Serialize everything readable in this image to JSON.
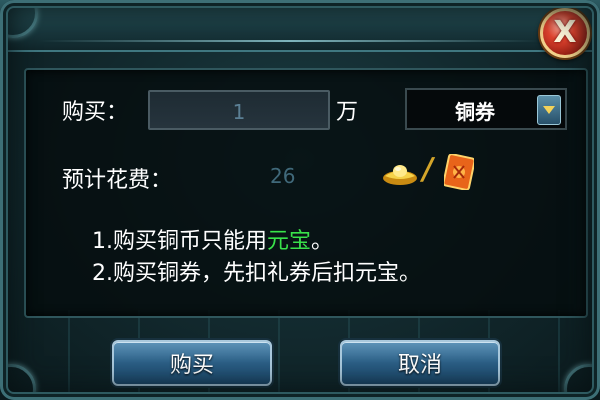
{
  "dialog": {
    "close_label": "X"
  },
  "form": {
    "buy_label": "购买：",
    "quantity_value": "1",
    "unit_label": "万",
    "currency_selected": "铜券",
    "cost_label": "预计花费：",
    "cost_value": "26"
  },
  "tips": {
    "line1_prefix": "1.购买铜币只能用",
    "line1_highlight": "元宝",
    "line1_suffix": "。",
    "line2": "2.购买铜券，先扣礼券后扣元宝。"
  },
  "buttons": {
    "buy": "购买",
    "cancel": "取消"
  },
  "icons": {
    "currency_dropdown": "chevron-down-icon",
    "gold_ingot": "gold-ingot-icon",
    "coupon": "coupon-icon",
    "close": "close-icon"
  },
  "colors": {
    "highlight": "#39e24a",
    "cost_text": "#40697a"
  }
}
